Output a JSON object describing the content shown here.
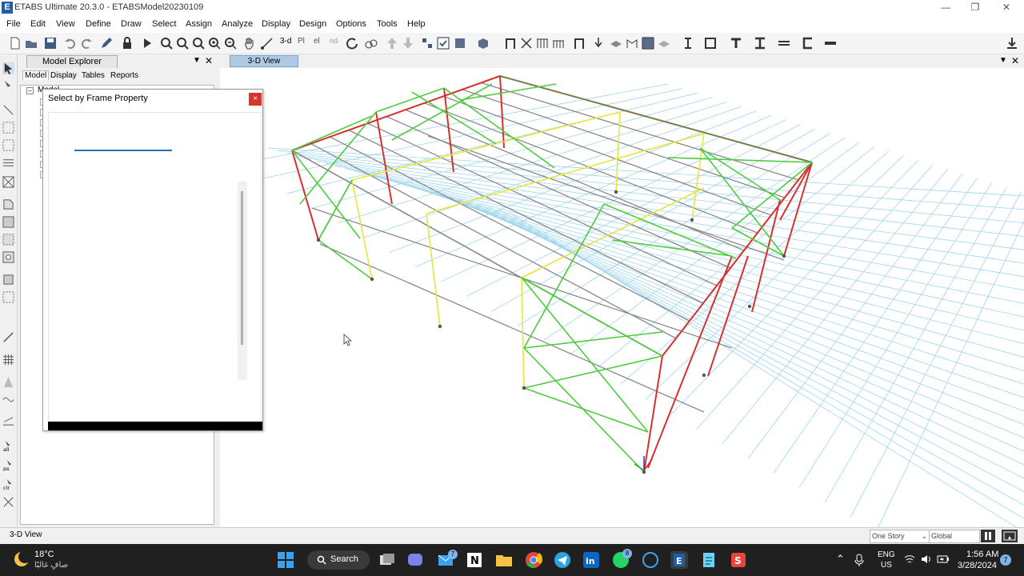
{
  "window": {
    "logo": "E",
    "title": "ETABS Ultimate 20.3.0 - ETABSModel20230109",
    "controls": {
      "minimize": "—",
      "restore": "❐",
      "close": "✕"
    }
  },
  "menu": [
    "File",
    "Edit",
    "View",
    "Define",
    "Draw",
    "Select",
    "Assign",
    "Analyze",
    "Display",
    "Design",
    "Options",
    "Tools",
    "Help"
  ],
  "toolbar": {
    "view_3d": "3-d",
    "plan": "Pl",
    "elev": "el",
    "nd": "nd"
  },
  "explorer": {
    "title": "Model Explorer",
    "tabs": [
      "Model",
      "Display",
      "Tables",
      "Reports"
    ],
    "tree_root": "Model",
    "pin": "▼",
    "close": "✕"
  },
  "dialog": {
    "title": "Select by Frame Property",
    "close": "×"
  },
  "view": {
    "tab_label": "3-D View",
    "pin": "▼",
    "close": "✕"
  },
  "statusbar": {
    "text": "3-D View",
    "story_combo": "One Story",
    "coord_combo": "Global"
  },
  "taskbar": {
    "weather_temp": "18°C",
    "weather_desc": "صافٍ غالبًا",
    "search_label": "Search",
    "lang_top": "ENG",
    "lang_bottom": "US",
    "time": "1:56 AM",
    "date": "3/28/2024",
    "notification_count": "7",
    "mail_badge": "7",
    "whatsapp_badge": "8"
  },
  "colors": {
    "columns": "#d83030",
    "braces": "#4ccc3c",
    "beams_yellow": "#e6e63c",
    "beams_gray": "#8a8a8a",
    "grid": "#9ed6ee",
    "accent": "#2a6fba"
  }
}
